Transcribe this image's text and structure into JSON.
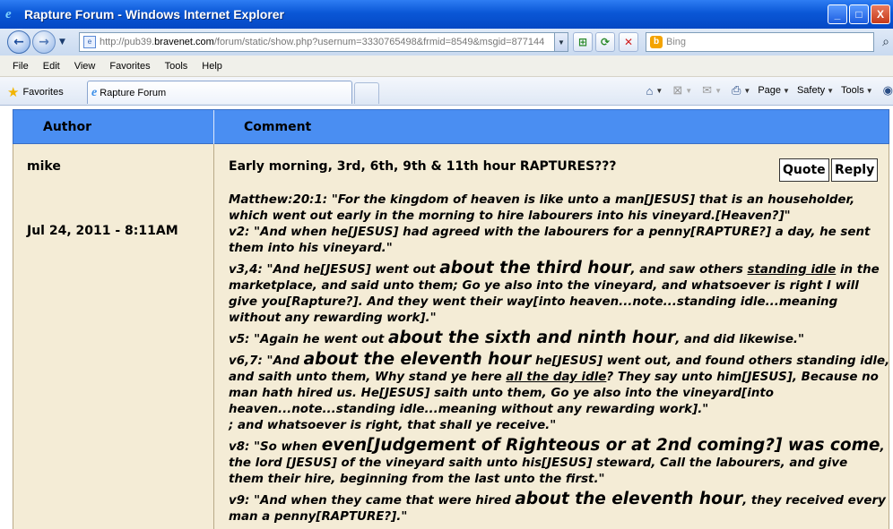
{
  "window": {
    "title": "Rapture Forum - Windows Internet Explorer",
    "min": "_",
    "max": "□",
    "close": "X"
  },
  "address": {
    "url_prefix": "http://pub39.",
    "url_domain": "bravenet.com",
    "url_rest": "/forum/static/show.php?usernum=3330765498&frmid=8549&msgid=877144",
    "search_placeholder": "Bing"
  },
  "menu": [
    "File",
    "Edit",
    "View",
    "Favorites",
    "Tools",
    "Help"
  ],
  "favorites_bar": {
    "favorites": "Favorites",
    "tab_title": "Rapture Forum",
    "tools": [
      "Page",
      "Safety",
      "Tools"
    ]
  },
  "forum": {
    "col_author": "Author",
    "col_comment": "Comment",
    "post": {
      "author": "mike",
      "date": "Jul 24, 2011 - 8:11AM",
      "subject": "Early morning, 3rd, 6th, 9th & 11th hour RAPTURES???",
      "quote_label": "Quote",
      "reply_label": "Reply",
      "lines": {
        "l1": "Matthew:20:1: \"For the kingdom of heaven is like unto a man[JESUS] that is an householder,",
        "l2": "which went out early in the morning to hire labourers into his vineyard.[Heaven?]\"",
        "l3": "v2: \"And when he[JESUS] had agreed with the labourers for a penny[RAPTURE?] a day, he sent",
        "l4": "them into his vineyard.\"",
        "l5a": "v3,4: \"And he[JESUS] went out ",
        "l5b": "about the third hour",
        "l5c": ", and saw others ",
        "l5d": "standing idle",
        "l5e": " in the",
        "l6": "marketplace, and said unto them; Go ye also into the vineyard, and whatsoever is right I will",
        "l7": "give you[Rapture?]. And they went their way[into heaven...note...standing idle...meaning",
        "l8": "without any rewarding work].\"",
        "l9a": "v5: \"Again he went out ",
        "l9b": "about the sixth and ninth hour",
        "l9c": ", and did likewise.\"",
        "l10a": "v6,7: \"And ",
        "l10b": "about the eleventh hour",
        "l10c": " he[JESUS] went out, and found others standing idle,",
        "l11a": "and saith unto them, Why stand ye here ",
        "l11b": "all the day idle",
        "l11c": "? They say unto him[JESUS], Because no",
        "l12": "man hath hired us. He[JESUS] saith unto them, Go ye also into the vineyard[into",
        "l13": "heaven...note...standing idle...meaning without any rewarding work].\"",
        "l14": "; and whatsoever is right, that shall ye receive.\"",
        "l15a": "v8: \"So when ",
        "l15b": "even[Judgement of Righteous or at 2nd coming?] was come",
        "l15c": ",",
        "l16": "the lord [JESUS] of the vineyard saith unto his[JESUS] steward, Call the labourers, and give",
        "l17": "them their hire, beginning from the last unto the first.\"",
        "l18a": "v9: \"And when they came that were hired ",
        "l18b": "about the eleventh hour",
        "l18c": ", they received every",
        "l19": "man a penny[RAPTURE?].\""
      }
    }
  }
}
